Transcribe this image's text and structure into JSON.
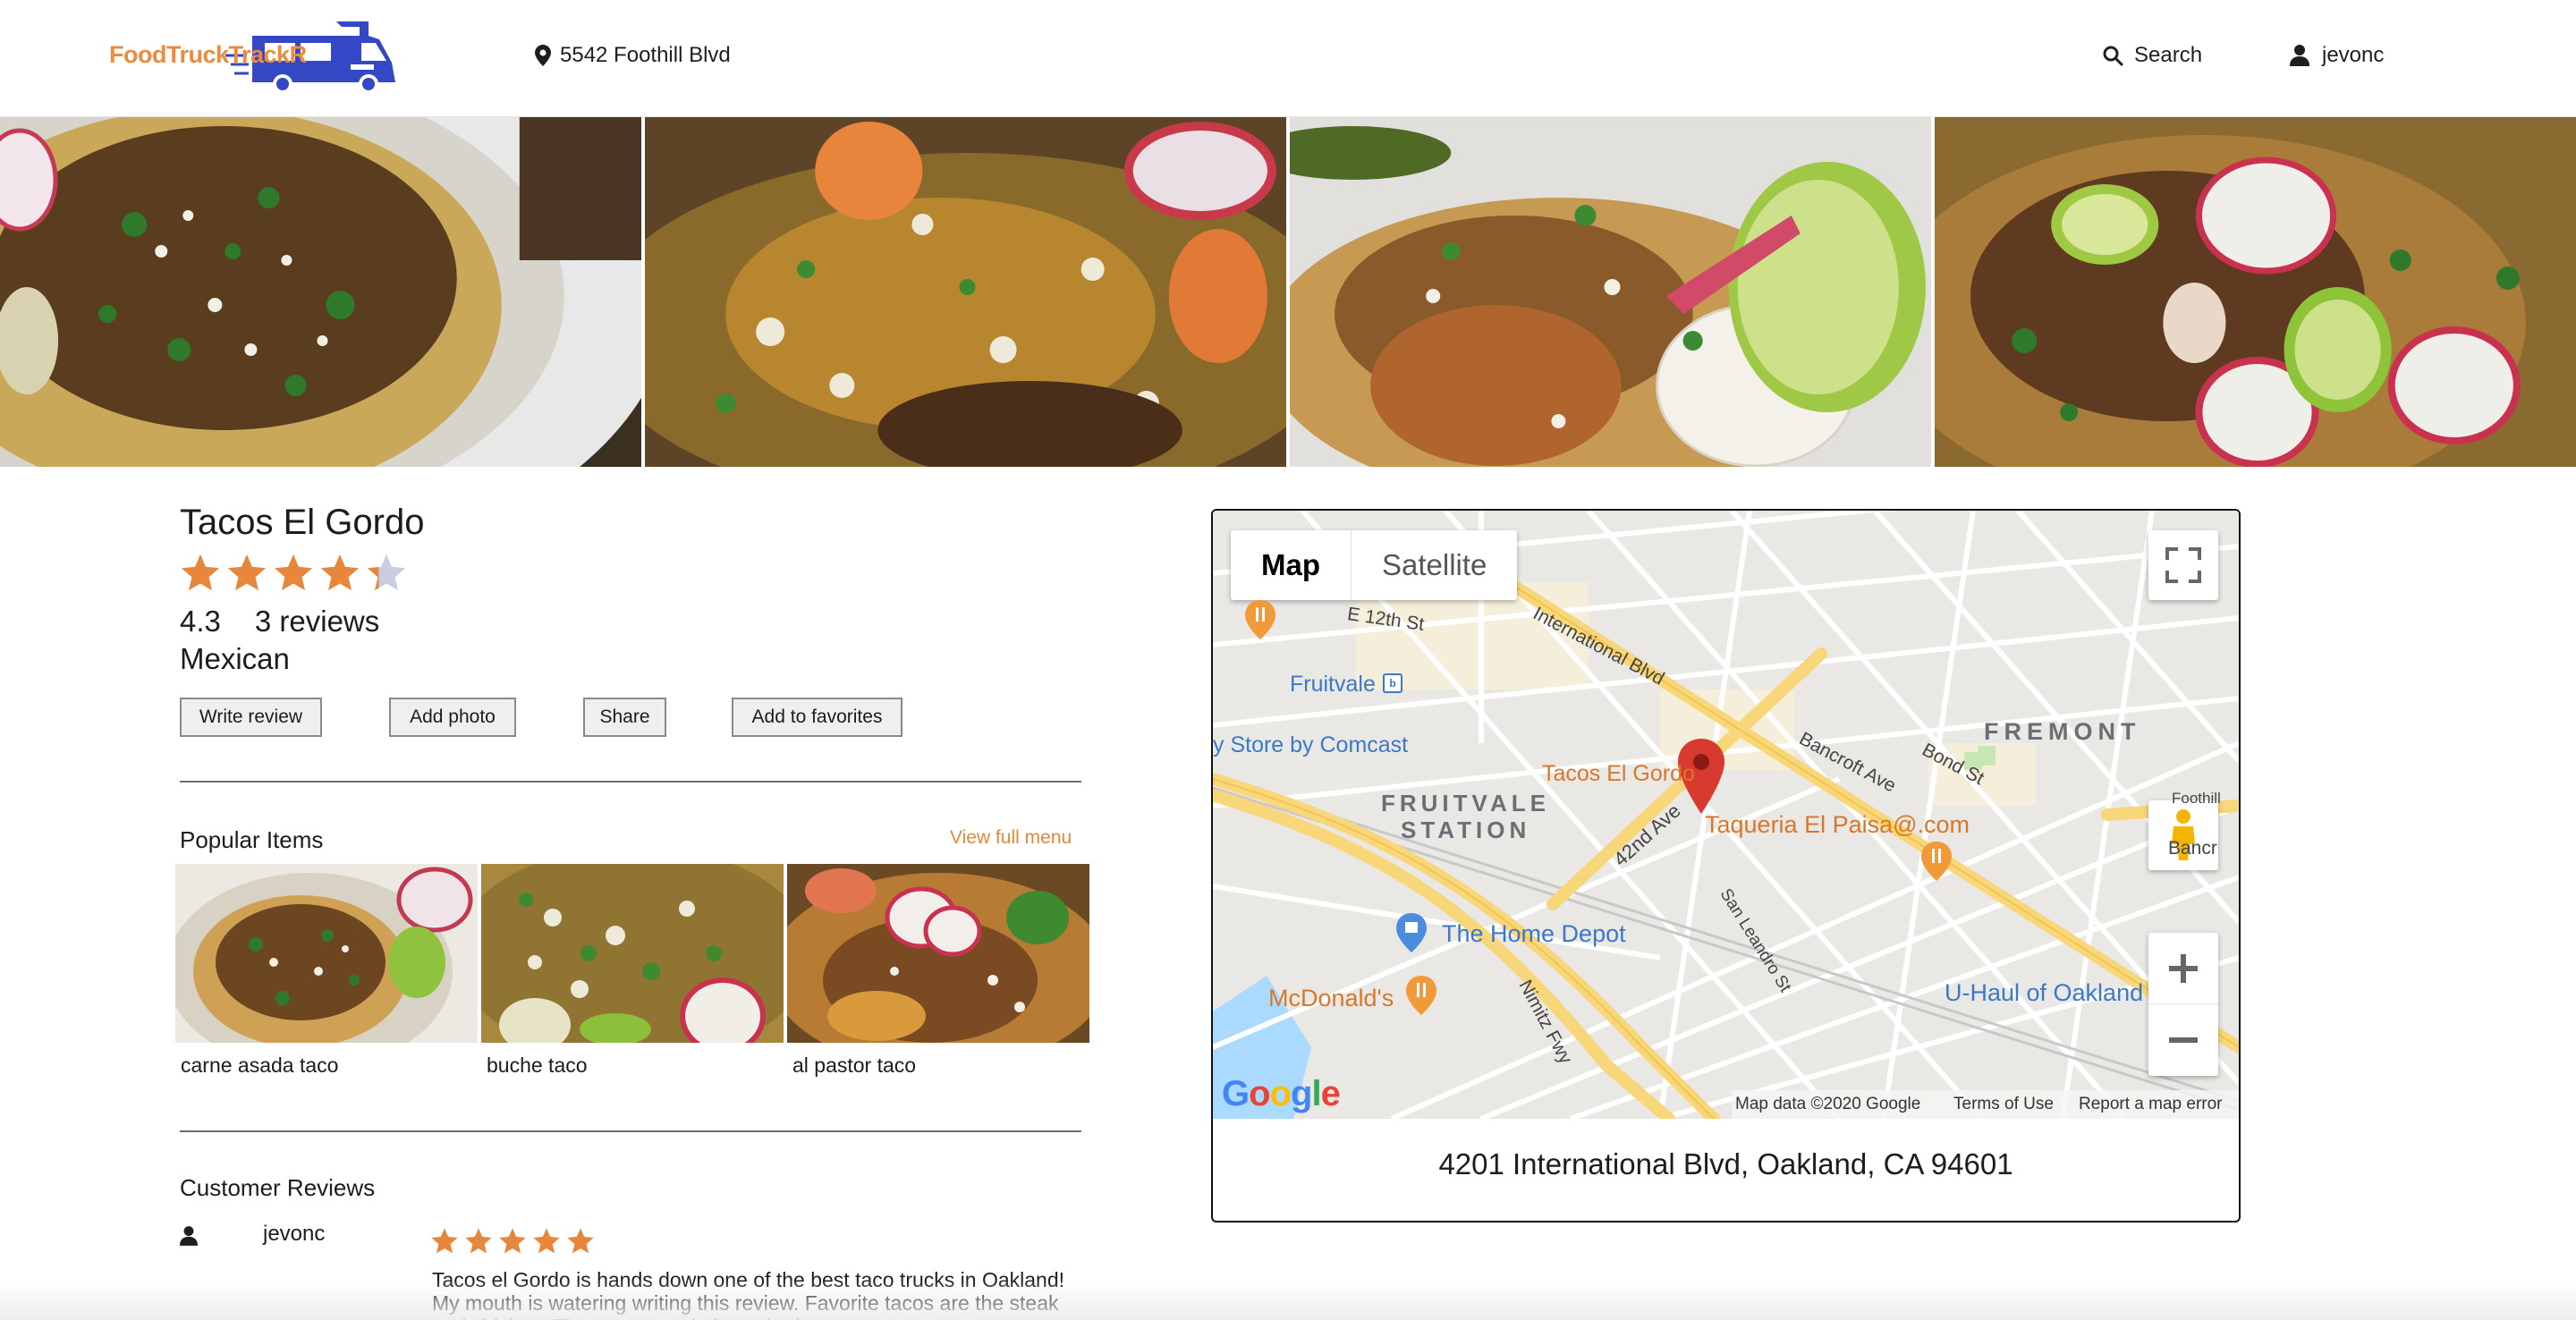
{
  "header": {
    "logo_text": "FoodTruckTrackR",
    "location": "5542 Foothill Blvd",
    "search_label": "Search",
    "username": "jevonc"
  },
  "truck": {
    "name": "Tacos El Gordo",
    "rating": 4.3,
    "rating_text": "4.3",
    "reviews_text": "3 reviews",
    "cuisine": "Mexican",
    "stars_filled": 4.3
  },
  "actions": {
    "write_review": "Write review",
    "add_photo": "Add photo",
    "share": "Share",
    "add_favorites": "Add to favorites"
  },
  "popular": {
    "title": "Popular Items",
    "view_menu": "View full menu",
    "items": [
      {
        "label": "carne asada taco"
      },
      {
        "label": "buche taco"
      },
      {
        "label": "al pastor taco"
      }
    ]
  },
  "reviews": {
    "title": "Customer Reviews",
    "items": [
      {
        "user": "jevonc",
        "stars": 5,
        "text": "Tacos el Gordo is hands down one of the best taco trucks in Oakland! My mouth is watering writing this review. Favorite tacos are the steak and chicken. The carne asada is cooked to"
      }
    ]
  },
  "map": {
    "tab_map": "Map",
    "tab_satellite": "Satellite",
    "labels": {
      "tacos_el_gordo": "Tacos El Gordo",
      "taqueria": "Taqueria El Paisa@.com",
      "fruitvale": "Fruitvale",
      "store_comcast": "y Store by Comcast",
      "fruitvale_station_1": "FRUITVALE",
      "fruitvale_station_2": "STATION",
      "fremont": "FREMONT",
      "home_depot": "The Home Depot",
      "mcdonalds": "McDonald's",
      "uhaul": "U-Haul of Oakland",
      "international_blvd": "International Blvd",
      "e12th": "E 12th St",
      "ave42": "42nd Ave",
      "bancroft": "Bancroft Ave",
      "bond": "Bond St",
      "nimitz": "Nimitz Fwy",
      "san_leandro": "San Leandro St",
      "foothill": "Foothill",
      "bancr": "Bancr"
    },
    "footer": {
      "data": "Map data ©2020 Google",
      "terms": "Terms of Use",
      "report": "Report a map error"
    },
    "address": "4201 International Blvd, Oakland, CA 94601"
  },
  "colors": {
    "accent": "#e8873b",
    "star": "#e8873b",
    "star_empty": "#c9cde2",
    "logo_truck": "#3447c4",
    "pin": "#d93a2f"
  }
}
